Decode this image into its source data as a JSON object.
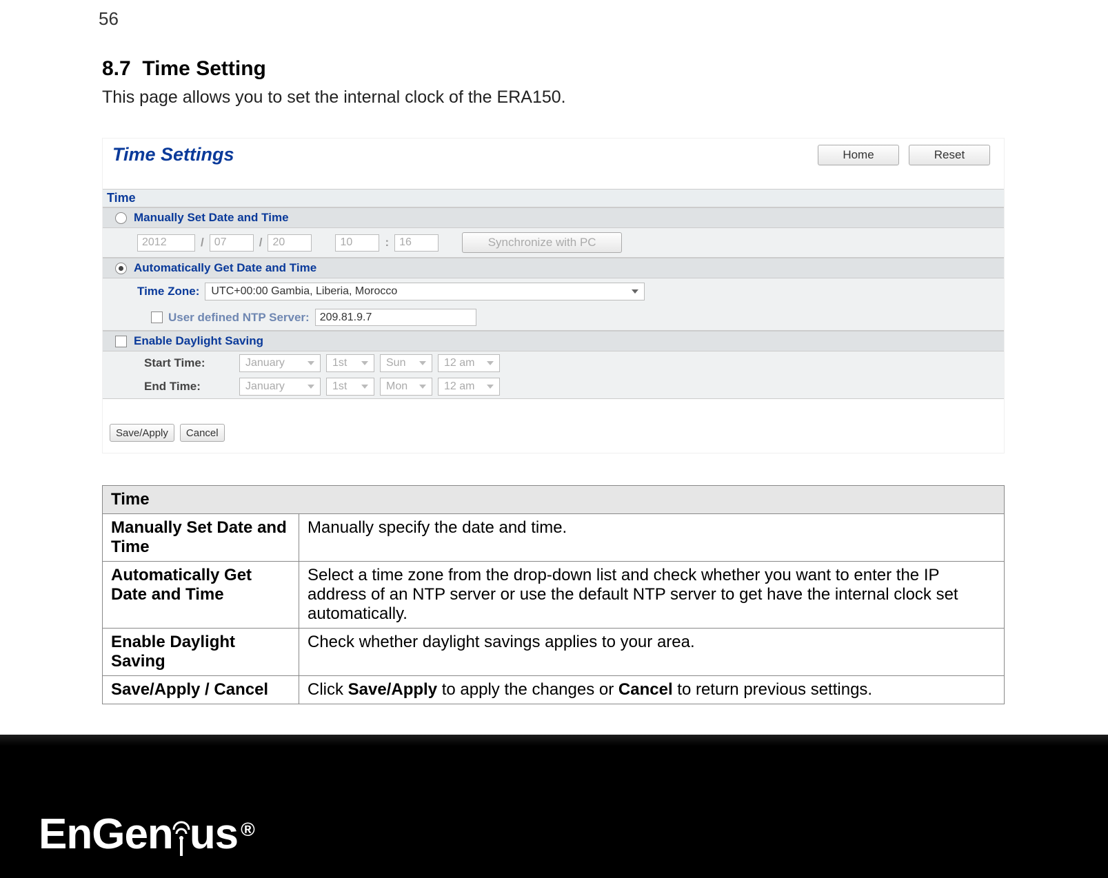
{
  "page_number": "56",
  "section": {
    "number": "8.7",
    "title": "Time Setting",
    "intro": "This page allows you to set the internal clock of the ERA150."
  },
  "screenshot": {
    "title": "Time Settings",
    "home_label": "Home",
    "reset_label": "Reset",
    "time_header": "Time",
    "manual": {
      "label": "Manually Set Date and Time",
      "year": "2012",
      "month": "07",
      "day": "20",
      "hour": "10",
      "minute": "16",
      "slash": "/",
      "colon": ":",
      "sync_label": "Synchronize with PC"
    },
    "auto": {
      "label": "Automatically Get Date and Time",
      "tz_label": "Time Zone:",
      "tz_value": "UTC+00:00 Gambia, Liberia, Morocco",
      "ntp_label": "User defined NTP Server:",
      "ntp_value": "209.81.9.7"
    },
    "daylight": {
      "label": "Enable Daylight Saving",
      "start_label": "Start Time:",
      "end_label": "End Time:",
      "start": {
        "month": "January",
        "day": "1st",
        "dow": "Sun",
        "hour": "12 am"
      },
      "end": {
        "month": "January",
        "day": "1st",
        "dow": "Mon",
        "hour": "12 am"
      }
    },
    "save_label": "Save/Apply",
    "cancel_label": "Cancel"
  },
  "table": {
    "header": "Time",
    "rows": [
      {
        "key": "Manually Set Date and Time",
        "desc": "Manually specify the date and time."
      },
      {
        "key": "Automatically Get Date and Time",
        "desc": "Select a time zone from the drop-down list and check whether you want to enter the IP address of an NTP server or use the default NTP server to get have the internal clock set automatically."
      },
      {
        "key": "Enable Daylight Saving",
        "desc": "Check whether daylight savings applies to your area."
      },
      {
        "key": "Save/Apply / Cancel",
        "desc_pre": "Click ",
        "b1": "Save/Apply",
        "desc_mid": " to apply the changes or ",
        "b2": "Cancel",
        "desc_post": " to return previous settings."
      }
    ]
  },
  "brand": "EnGenius"
}
